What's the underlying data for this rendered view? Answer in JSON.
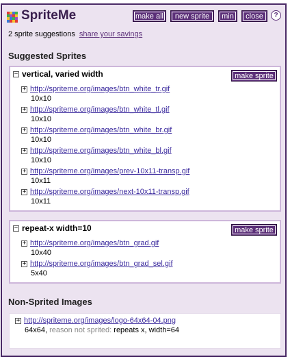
{
  "app": {
    "title": "SpriteMe",
    "buttons": {
      "make_all": "make all",
      "new_sprite": "new sprite",
      "min": "min",
      "close": "close"
    },
    "help_symbol": "?"
  },
  "summary": {
    "text": "2 sprite suggestions",
    "link": "share your savings"
  },
  "suggested": {
    "heading": "Suggested Sprites",
    "make_sprite_label": "make sprite",
    "toggle_symbol": "−",
    "item_toggle_symbol": "+",
    "groups": [
      {
        "title": "vertical, varied width",
        "images": [
          {
            "url": "http://spriteme.org/images/btn_white_tr.gif",
            "size": "10x10"
          },
          {
            "url": "http://spriteme.org/images/btn_white_tl.gif",
            "size": "10x10"
          },
          {
            "url": "http://spriteme.org/images/btn_white_br.gif",
            "size": "10x10"
          },
          {
            "url": "http://spriteme.org/images/btn_white_bl.gif",
            "size": "10x10"
          },
          {
            "url": "http://spriteme.org/images/prev-10x11-transp.gif",
            "size": "10x11"
          },
          {
            "url": "http://spriteme.org/images/next-10x11-transp.gif",
            "size": "10x11"
          }
        ]
      },
      {
        "title": "repeat-x width=10",
        "images": [
          {
            "url": "http://spriteme.org/images/btn_grad.gif",
            "size": "10x40"
          },
          {
            "url": "http://spriteme.org/images/btn_grad_sel.gif",
            "size": "5x40"
          }
        ]
      }
    ]
  },
  "non_sprited": {
    "heading": "Non-Sprited Images",
    "images": [
      {
        "url": "http://spriteme.org/images/logo-64x64-04.png",
        "size": "64x64,",
        "reason_label": "reason not sprited:",
        "reason": "repeats x, width=64"
      }
    ]
  },
  "colors": {
    "accent": "#5B2F78",
    "panel_bg": "#ECE3F0",
    "link": "#3B2A9E"
  }
}
